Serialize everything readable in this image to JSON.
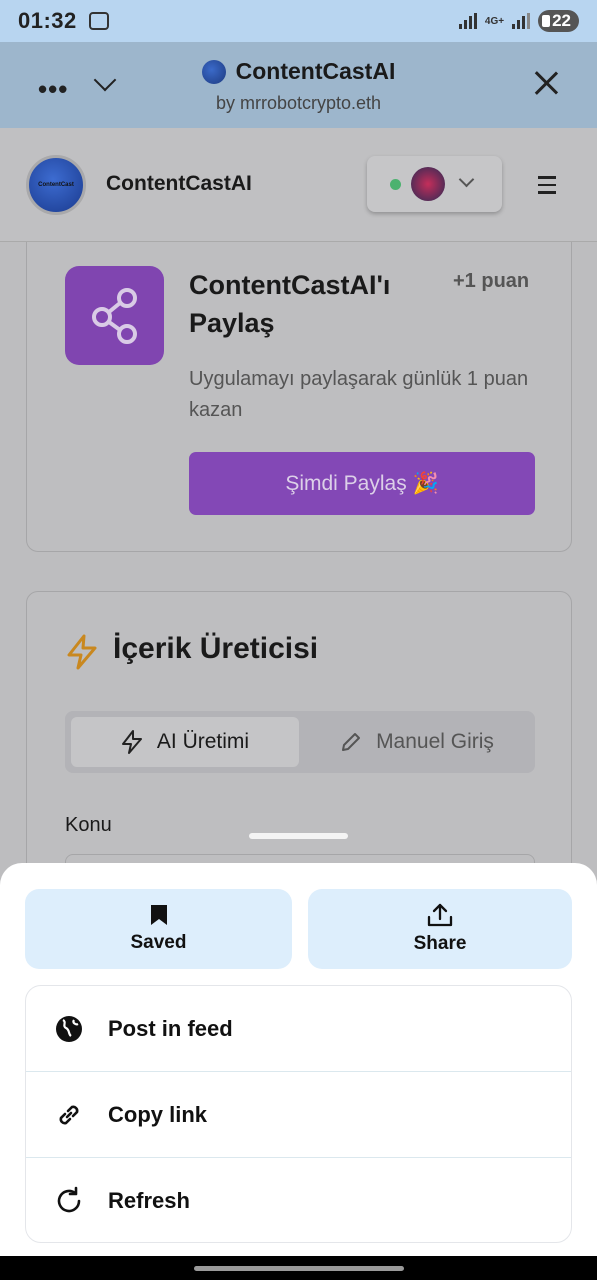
{
  "status_bar": {
    "time": "01:32",
    "network": "4G+",
    "battery": "22"
  },
  "app_bar": {
    "title": "ContentCastAI",
    "subtitle": "by mrrobotcrypto.eth"
  },
  "header": {
    "app_name": "ContentCastAI",
    "logo_text": "ContentCast"
  },
  "share_card": {
    "title": "ContentCastAI'ı Paylaş",
    "points": "+1 puan",
    "description": "Uygulamayı paylaşarak günlük 1 puan kazan",
    "button": "Şimdi Paylaş 🎉"
  },
  "generator_card": {
    "title": "İçerik Üreticisi",
    "tabs": [
      {
        "label": "AI Üretimi"
      },
      {
        "label": "Manuel Giriş"
      }
    ],
    "topic_label": "Konu"
  },
  "sheet": {
    "quick_actions": [
      {
        "label": "Saved",
        "icon": "bookmark-icon"
      },
      {
        "label": "Share",
        "icon": "share-upload-icon"
      }
    ],
    "items": [
      {
        "label": "Post in feed",
        "icon": "globe-icon"
      },
      {
        "label": "Copy link",
        "icon": "link-icon"
      },
      {
        "label": "Refresh",
        "icon": "refresh-icon"
      }
    ]
  },
  "colors": {
    "accent_purple": "#8348b6",
    "quick_action_bg": "#ddeefc",
    "status_online": "#4cb26f"
  }
}
